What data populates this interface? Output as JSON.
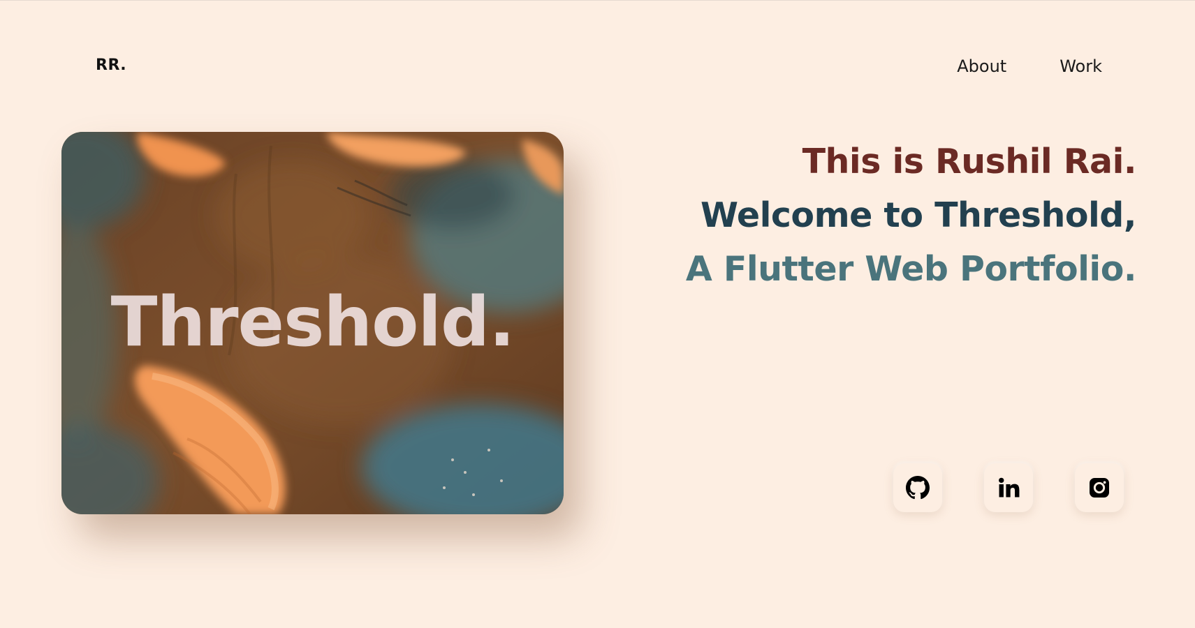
{
  "header": {
    "logo": "RR.",
    "nav": [
      {
        "label": "About"
      },
      {
        "label": "Work"
      }
    ]
  },
  "hero": {
    "card_title": "Threshold.",
    "lines": [
      {
        "text": "This is Rushil Rai.",
        "color": "#6b2a24"
      },
      {
        "text": "Welcome to Threshold,",
        "color": "#22404f"
      },
      {
        "text": "A Flutter Web Portfolio.",
        "color": "#4a747c"
      }
    ]
  },
  "social": [
    {
      "icon": "github-icon"
    },
    {
      "icon": "linkedin-icon"
    },
    {
      "icon": "instagram-icon"
    }
  ],
  "colors": {
    "background": "#fdeee2",
    "accent_primary": "#6b2a24",
    "accent_secondary": "#22404f",
    "accent_tertiary": "#4a747c"
  }
}
